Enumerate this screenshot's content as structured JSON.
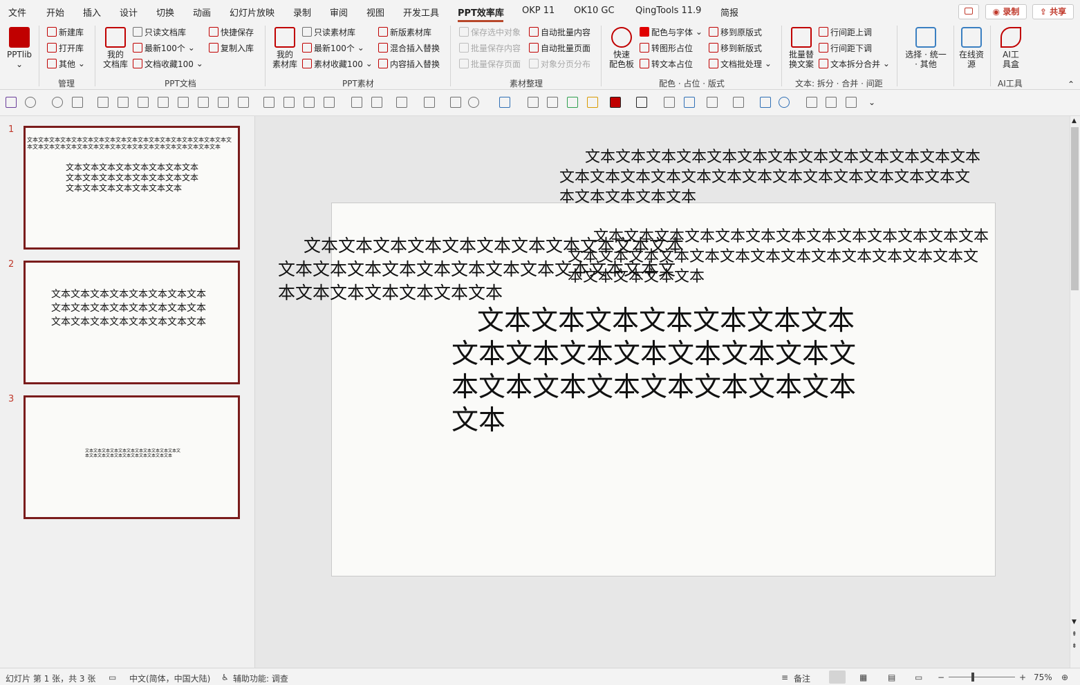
{
  "menu": {
    "tabs": [
      "文件",
      "开始",
      "插入",
      "设计",
      "切换",
      "动画",
      "幻灯片放映",
      "录制",
      "审阅",
      "视图",
      "开发工具",
      "PPT效率库",
      "OKP 11",
      "OK10 GC",
      "QingTools 11.9",
      "简报"
    ],
    "active_tab": "PPT效率库",
    "record_label": "录制",
    "share_label": "共享"
  },
  "ribbon": {
    "pptlib": "PPTlib",
    "manage": {
      "new_lib": "新建库",
      "open_lib": "打开库",
      "other": "其他",
      "label": "管理"
    },
    "doc": {
      "my_lib": "我的\n文档库",
      "readonly": "只读文档库",
      "recent": "最新100个",
      "fav": "文档收藏100",
      "quick_save": "快捷保存",
      "copy_in": "复制入库",
      "label": "PPT文档"
    },
    "material": {
      "my_lib": "我的\n素材库",
      "readonly": "只读素材库",
      "recent": "最新100个",
      "fav": "素材收藏100",
      "new_lib": "新版素材库",
      "mix_insert": "混合插入替换",
      "content_insert": "内容插入替换",
      "label": "PPT素材"
    },
    "organize": {
      "save_sel": "保存选中对象",
      "batch_content": "批量保存内容",
      "batch_page": "批量保存页面",
      "auto_content": "自动批量内容",
      "auto_page": "自动批量页面",
      "split_page": "对象分页分布",
      "label": "素材整理"
    },
    "color": {
      "palette": "快速\n配色板",
      "color_font": "配色与字体",
      "to_shape": "转图形占位",
      "to_text": "转文本占位",
      "to_orig": "移到原版式",
      "to_new": "移到新版式",
      "batch_doc": "文档批处理",
      "label": "配色 · 占位 · 版式"
    },
    "text": {
      "batch_replace": "批量替\n换文案",
      "line_up": "行间距上调",
      "line_down": "行间距下调",
      "split_merge": "文本拆分合并",
      "label": "文本: 拆分 · 合并 · 间距"
    },
    "select": {
      "label_btn": "选择 · 统一\n· 其他"
    },
    "online": {
      "label_btn": "在线资\n源"
    },
    "ai": {
      "label_btn": "AI工\n具盒",
      "label": "AI工具"
    }
  },
  "slides": [
    {
      "num": "1",
      "line": "文本文本文本文本文本文本文本文本文本文本文本文本文本文本文本文本文本文本文本文本文本文本文本文本文本文本文本文本文本文本文本文本文本文本文本文本",
      "main": "文本文本文本文本文本文本文本文本文本文本文本文本文本文本文本文本文本文本文本文本文本文本文本"
    },
    {
      "num": "2",
      "main": "文本文本文本文本文本文本文本文本文本文本文本文本文本文本文本文本文本文本文本文本文本文本文本文本"
    },
    {
      "num": "3",
      "main": "文本文本文本文本文本文本文本文本文本文本文本文本文本文本文本文本文本文本文本文本文本文本"
    }
  ],
  "canvas": {
    "box_top_right": "文本文本文本文本文本文本文本文本文本文本文本文本文本文本文本文本文本文本文本文本文本文本文本文本文本文本文本文本文本文本文本",
    "box_mid_right": "文本文本文本文本文本文本文本文本文本文本文本文本文本文本文本文本文本文本文本文本文本文本文本文本文本文本文本文本文本文本文本",
    "box_left": "文本文本文本文本文本文本文本文本文本文本文本文本文本文本文本文本文本文本文本文本文本文本文本文本文本文本文本文本文本",
    "box_main": "文本文本文本文本文本文本文本文本文本文本文本文本文本文本文本文本文本文本文本文本文本文本文本"
  },
  "status": {
    "slide_info": "幻灯片 第 1 张，共 3 张",
    "language": "中文(简体，中国大陆)",
    "accessibility": "辅助功能: 调查",
    "notes": "备注",
    "zoom": "75%"
  }
}
